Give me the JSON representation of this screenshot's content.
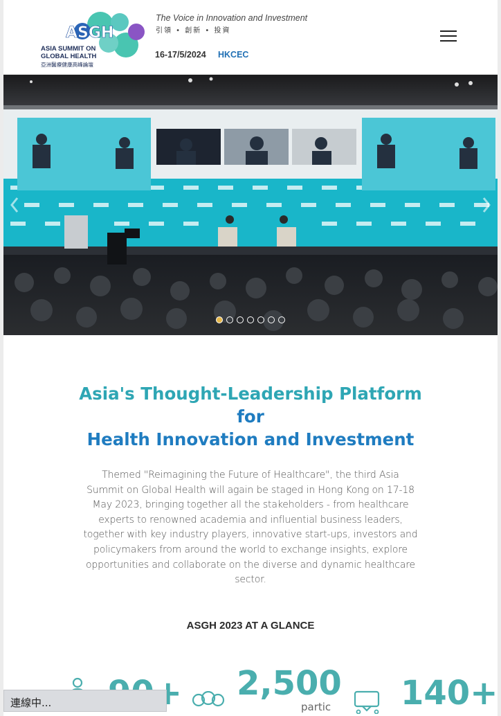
{
  "header": {
    "logo_mark": "ASGH",
    "logo_line1": "ASIA SUMMIT ON",
    "logo_line2": "GLOBAL HEALTH",
    "logo_cn": "亞洲醫療健康高峰論壇",
    "tagline": "The Voice in Innovation and Investment",
    "tagline_cn": "引領 • 創新 • 投資",
    "dates": "16-17/5/2024",
    "venue": "HKCEC",
    "menu_icon": "hamburger-menu-icon"
  },
  "hero": {
    "slide_count": 7,
    "active_slide": 1,
    "prev_icon": "chevron-left-icon",
    "next_icon": "chevron-right-icon"
  },
  "intro": {
    "headline_line1": "Asia's Thought-Leadership Platform",
    "headline_line2": "for",
    "headline_line3": "Health Innovation and Investment",
    "body": "Themed \"Reimagining the Future of Healthcare\", the third Asia Summit on Global Health will again be staged in Hong Kong on 17-18 May 2023, bringing together all the stakeholders - from healthcare experts to renowned academia and influential business leaders, together with key industry players, innovative start-ups, investors and policymakers from around the world to exchange insights, explore opportunities and collaborate on the diverse and dynamic healthcare sector."
  },
  "glance": {
    "title": "ASGH 2023 AT A GLANCE",
    "stats": [
      {
        "value": "90+",
        "icon": "person-icon"
      },
      {
        "value": "2,500",
        "label": "partic",
        "icon": "people-group-icon"
      },
      {
        "value": "140+",
        "icon": "presentation-icon"
      }
    ]
  },
  "colors": {
    "accent_teal": "#4aaeae",
    "headline_blue": "#1f7cc0",
    "venue_blue": "#1f6fb4",
    "active_dot": "#e6b84c"
  },
  "status_bar": {
    "text": "連線中..."
  }
}
